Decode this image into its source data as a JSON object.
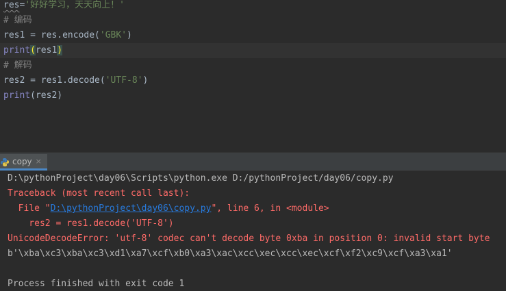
{
  "editor": {
    "line1": {
      "var": "res",
      "op": "=",
      "str": "'好好学习，天天向上！'"
    },
    "line2": {
      "comment": "# 编码"
    },
    "line3": {
      "lhs": "res1 = res.encode(",
      "arg": "'GBK'",
      "rhs": ")"
    },
    "line4": {
      "fn": "print",
      "open": "(",
      "arg": "res1",
      "close": ")"
    },
    "line5": {
      "comment": "# 解码"
    },
    "line6": {
      "lhs": "res2 = res1.decode(",
      "arg": "'UTF-8'",
      "rhs": ")"
    },
    "line7": {
      "fn": "print",
      "rest": "(res2)"
    }
  },
  "run_tab": {
    "label": "copy",
    "close_glyph": "×",
    "icon": "python-icon"
  },
  "console": {
    "command": "D:\\pythonProject\\day06\\Scripts\\python.exe D:/pythonProject/day06/copy.py",
    "traceback_header": "Traceback (most recent call last):",
    "file_prefix": "  File \"",
    "file_link": "D:\\pythonProject\\day06\\copy.py",
    "file_suffix": "\", line 6, in <module>",
    "code_line": "    res2 = res1.decode('UTF-8')",
    "error": "UnicodeDecodeError: 'utf-8' codec can't decode byte 0xba in position 0: invalid start byte",
    "output_bytes": "b'\\xba\\xc3\\xba\\xc3\\xd1\\xa7\\xcf\\xb0\\xa3\\xac\\xcc\\xec\\xcc\\xec\\xcf\\xf2\\xc9\\xcf\\xa3\\xa1'",
    "blank": "",
    "exit_message": "Process finished with exit code 1"
  },
  "colors": {
    "background": "#2b2b2b",
    "string": "#6a8759",
    "comment": "#808080",
    "builtin": "#8888c6",
    "error": "#ff6b68",
    "link": "#287bde",
    "tab_accent": "#4a88c7"
  }
}
